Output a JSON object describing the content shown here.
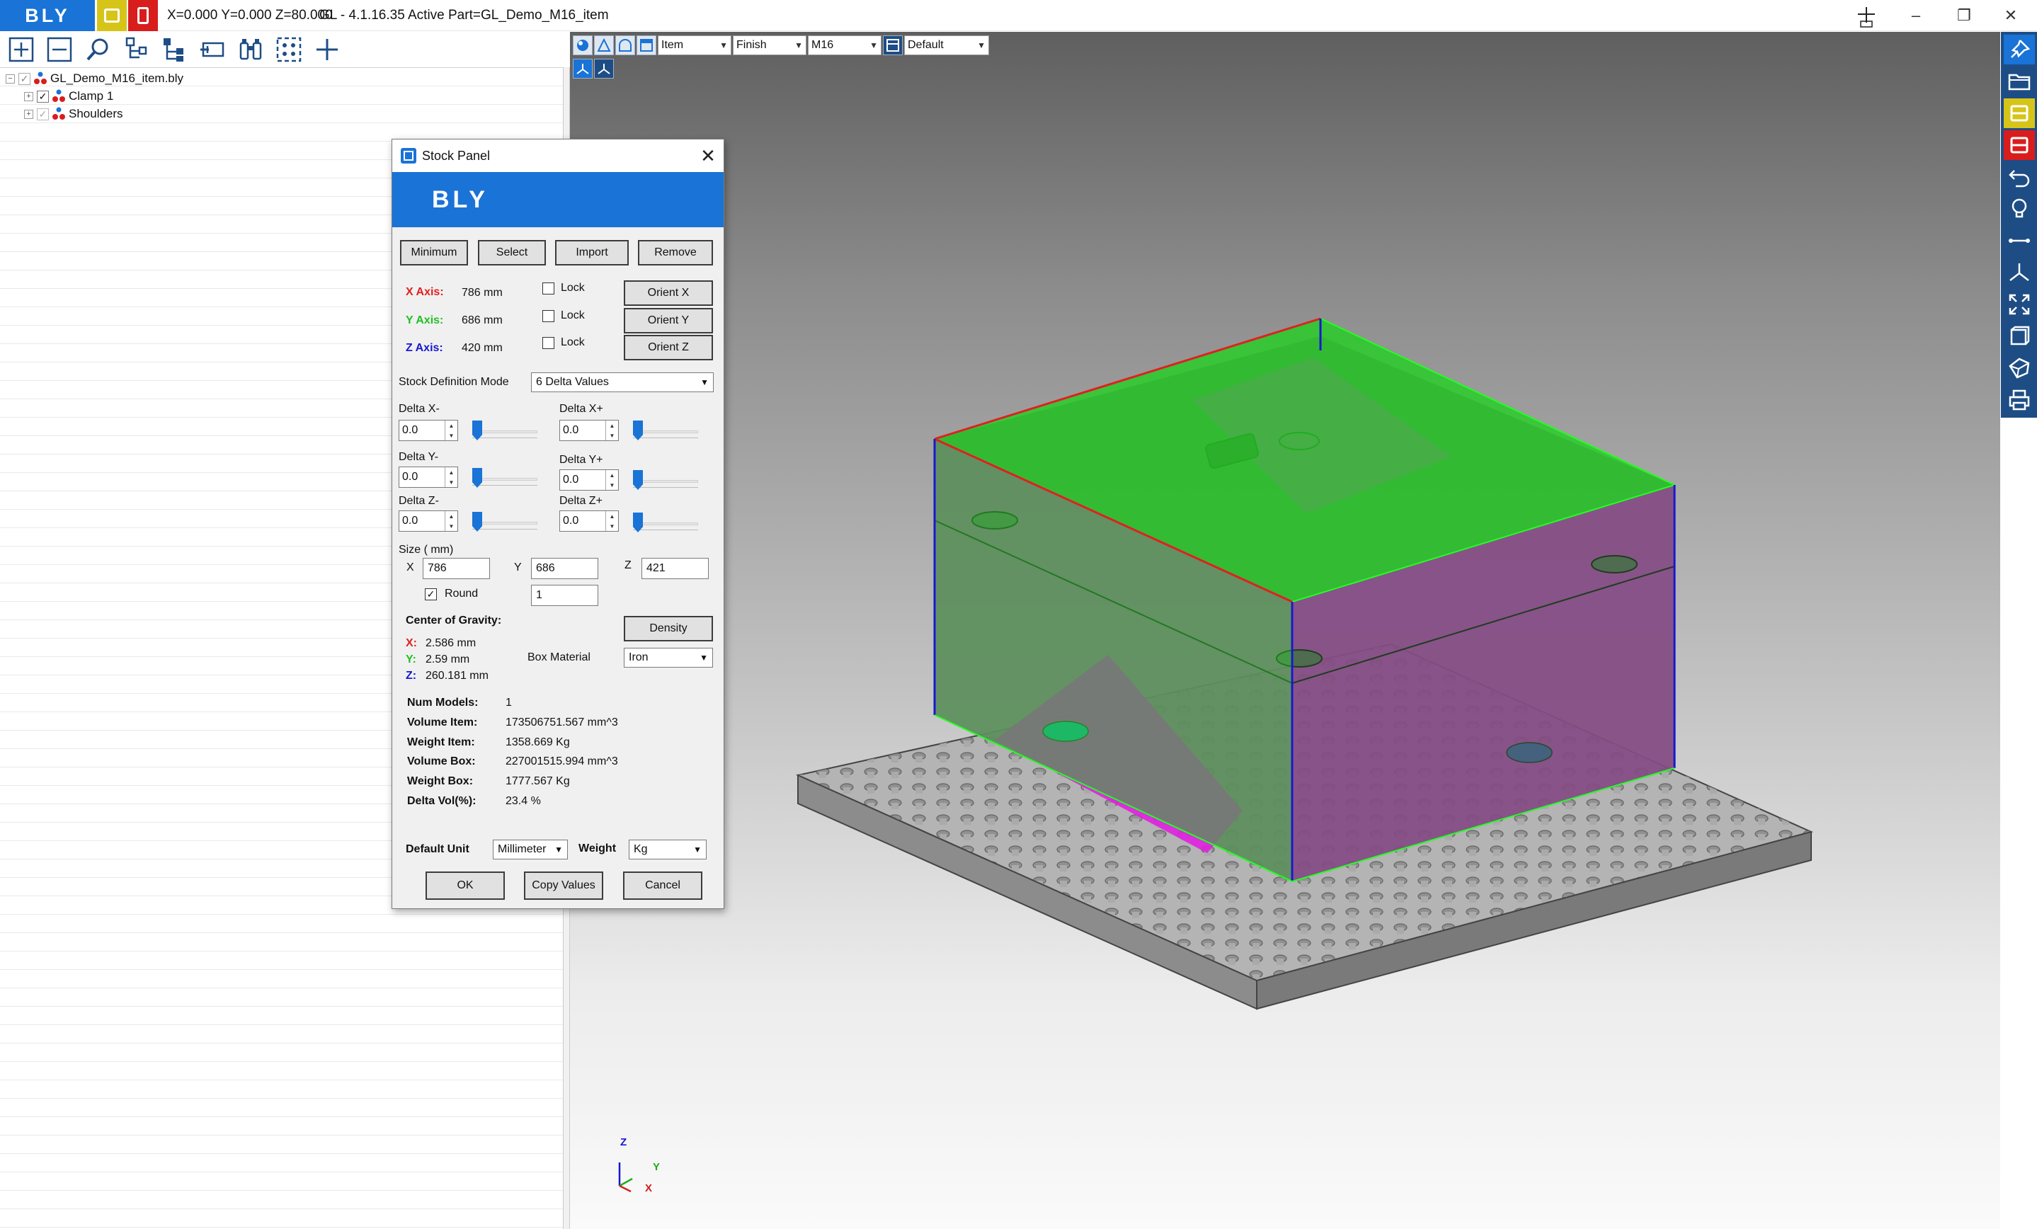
{
  "titlebar": {
    "logo_text": "BLY",
    "coords": "X=0.000 Y=0.000 Z=80.000",
    "app_title": "GL - 4.1.16.35 Active Part=GL_Demo_M16_item",
    "minimize": "–",
    "maximize": "❐",
    "close": "✕"
  },
  "tree": {
    "items": [
      {
        "label": "GL_Demo_M16_item.bly"
      },
      {
        "label": "Clamp 1"
      },
      {
        "label": "Shoulders"
      }
    ]
  },
  "viewport_toolbar": {
    "item_combo": "Item",
    "finish_combo": "Finish",
    "m16_combo": "M16",
    "default_combo": "Default"
  },
  "axes_triad": {
    "z": "Z",
    "y": "Y",
    "x": "X"
  },
  "colors": {
    "accent_blue": "#1a73d6",
    "brand_yellow": "#d6c419",
    "brand_red": "#d91d1d",
    "stock_green": "#22d022",
    "part_magenta": "#e020e0",
    "right_toolbar": "#1e4d85"
  },
  "dialog": {
    "title": "Stock Panel",
    "banner": "BLY",
    "close_glyph": "✕",
    "buttons": {
      "minimum": "Minimum",
      "select": "Select",
      "import": "Import",
      "remove": "Remove"
    },
    "axes": {
      "x_label": "X Axis:",
      "x_value": "786 mm",
      "y_label": "Y Axis:",
      "y_value": "686 mm",
      "z_label": "Z Axis:",
      "z_value": "420 mm",
      "lock_label": "Lock",
      "orient_x": "Orient X",
      "orient_y": "Orient Y",
      "orient_z": "Orient Z"
    },
    "mode_label": "Stock Definition Mode",
    "mode_value": "6 Delta Values",
    "deltas": {
      "x_minus_label": "Delta X-",
      "x_minus": "0.0",
      "x_plus_label": "Delta X+",
      "x_plus": "0.0",
      "y_minus_label": "Delta Y-",
      "y_minus": "0.0",
      "y_plus_label": "Delta Y+",
      "y_plus": "0.0",
      "z_minus_label": "Delta Z-",
      "z_minus": "0.0",
      "z_plus_label": "Delta Z+",
      "z_plus": "0.0"
    },
    "size": {
      "label": "Size ( mm)",
      "x_label": "X",
      "x": "786",
      "y_label": "Y",
      "y": "686",
      "z_label": "Z",
      "z": "421",
      "round_label": "Round",
      "round_value": "1"
    },
    "cog": {
      "label": "Center of Gravity:",
      "x_label": "X:",
      "x": "2.586 mm",
      "y_label": "Y:",
      "y": "2.59 mm",
      "z_label": "Z:",
      "z": "260.181 mm",
      "density_button": "Density",
      "box_material_label": "Box Material",
      "box_material_value": "Iron"
    },
    "stats": {
      "num_models_label": "Num Models:",
      "num_models": "1",
      "volume_item_label": "Volume Item:",
      "volume_item": "173506751.567 mm^3",
      "weight_item_label": "Weight Item:",
      "weight_item": "1358.669 Kg",
      "volume_box_label": "Volume Box:",
      "volume_box": "227001515.994 mm^3",
      "weight_box_label": "Weight Box:",
      "weight_box": "1777.567 Kg",
      "delta_vol_label": "Delta Vol(%):",
      "delta_vol": "23.4 %"
    },
    "units": {
      "default_unit_label": "Default Unit",
      "default_unit": "Millimeter",
      "weight_label": "Weight",
      "weight_unit": "Kg"
    },
    "footer": {
      "ok": "OK",
      "copy": "Copy Values",
      "cancel": "Cancel"
    }
  }
}
